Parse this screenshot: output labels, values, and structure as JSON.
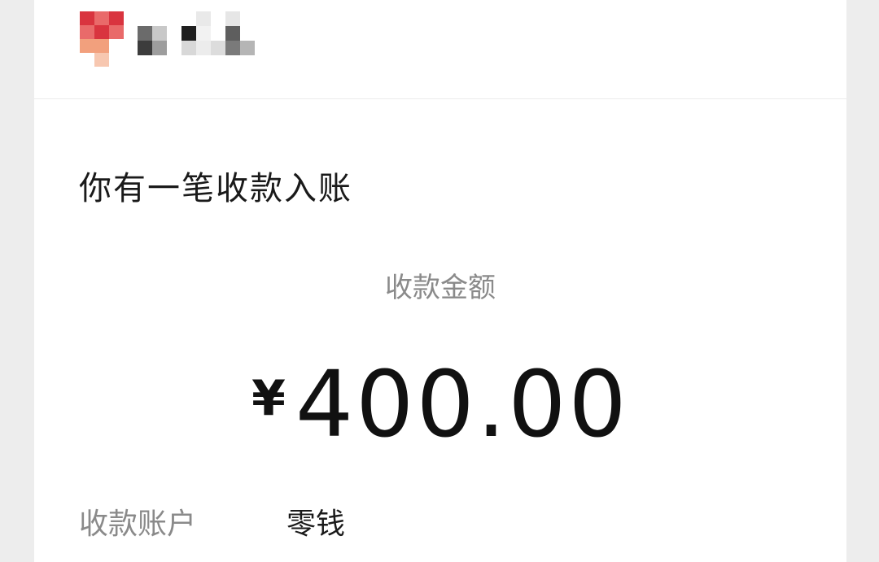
{
  "notification": {
    "title": "你有一笔收款入账",
    "amount_label": "收款金额",
    "currency_symbol": "¥",
    "amount_value": "400.00",
    "account_label": "收款账户",
    "account_value": "零钱"
  },
  "sender": {
    "avatar_icon": "pixelated-avatar-icon",
    "name_state": "pixelated-redacted",
    "avatar_colors": [
      "#d9343f",
      "#e96a6a",
      "#f2a07d",
      "#f7c7b0"
    ]
  },
  "colors": {
    "background": "#ededed",
    "card": "#ffffff",
    "primary_text": "#1a1a1a",
    "secondary_text": "#8a8a8a",
    "divider": "#ececec"
  }
}
